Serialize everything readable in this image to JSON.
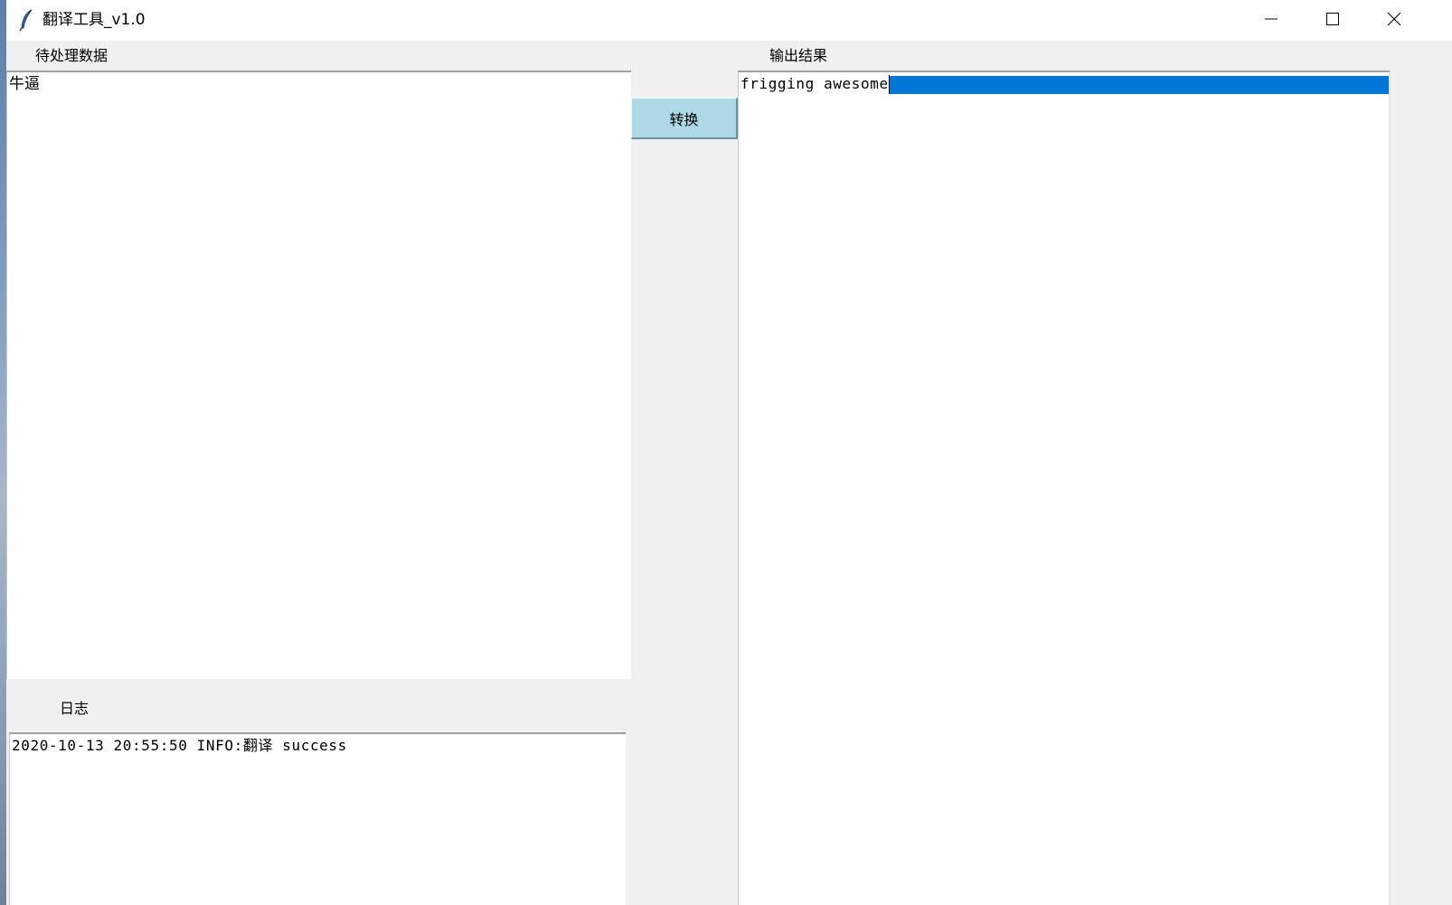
{
  "window": {
    "title": "翻译工具_v1.0",
    "icons": {
      "app": "feather-icon",
      "minimize": "minimize-icon",
      "maximize": "maximize-icon",
      "close": "close-icon"
    }
  },
  "input_panel": {
    "label": "待处理数据",
    "value": "牛逼"
  },
  "output_panel": {
    "label": "输出结果",
    "value": "frigging awesome"
  },
  "convert_button": {
    "label": "转换",
    "color": "#add8e6"
  },
  "log_panel": {
    "label": "日志",
    "lines": [
      "2020-10-13 20:55:50 INFO:翻译 success"
    ]
  },
  "colors": {
    "selection": "#0078d7",
    "background": "#f0f0f0"
  }
}
